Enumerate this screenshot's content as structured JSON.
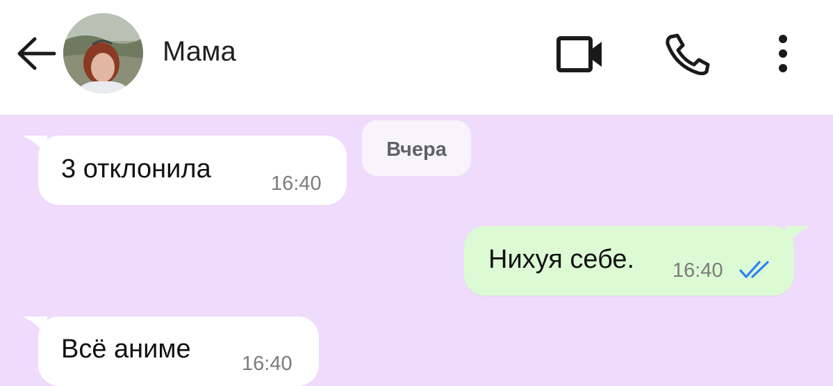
{
  "header": {
    "contact_name": "Мама",
    "back_icon": "arrow-left-icon",
    "avatar": "contact-photo",
    "actions": [
      "video-call-icon",
      "phone-icon",
      "more-vertical-icon"
    ]
  },
  "chat": {
    "date_separator": "Вчера",
    "messages": [
      {
        "direction": "incoming",
        "text": "3 отклонила",
        "time": "16:40"
      },
      {
        "direction": "outgoing",
        "text": "Нихуя себе.",
        "time": "16:40",
        "status": "read",
        "status_icon": "double-check-icon"
      },
      {
        "direction": "incoming",
        "text": "Всё аниме",
        "time": "16:40"
      }
    ]
  },
  "colors": {
    "chat_background": "#efdcfd",
    "incoming_bubble": "#ffffff",
    "outgoing_bubble": "#dcfbd4",
    "read_check": "#2f7ff5",
    "header_background": "#ffffff"
  }
}
